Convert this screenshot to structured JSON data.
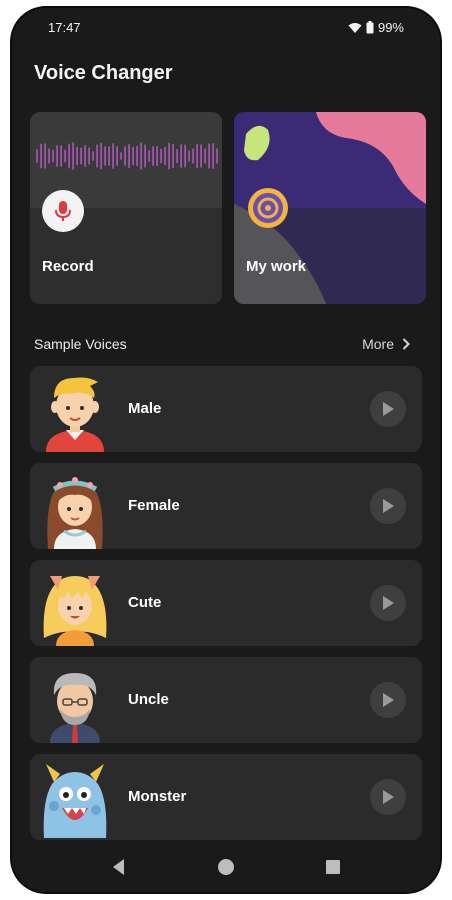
{
  "status": {
    "time": "17:47",
    "battery": "99%"
  },
  "app": {
    "title": "Voice Changer"
  },
  "cards": {
    "record": {
      "label": "Record"
    },
    "work": {
      "label": "My work"
    }
  },
  "section": {
    "title": "Sample Voices",
    "more": "More"
  },
  "voices": [
    {
      "name": "Male",
      "icon": "male-avatar-icon"
    },
    {
      "name": "Female",
      "icon": "female-avatar-icon"
    },
    {
      "name": "Cute",
      "icon": "cute-avatar-icon"
    },
    {
      "name": "Uncle",
      "icon": "uncle-avatar-icon"
    },
    {
      "name": "Monster",
      "icon": "monster-avatar-icon"
    }
  ],
  "icons": {
    "status": [
      "wifi-icon",
      "battery-icon"
    ],
    "record": "mic-icon",
    "work": "vinyl-disc-icon",
    "play": "play-icon",
    "more": "chevron-right-icon",
    "nav": [
      "back-icon",
      "home-icon",
      "recents-icon"
    ]
  },
  "colors": {
    "background": "#1a1a1a",
    "card": "#2b2b2b",
    "work_card": "#3b2b77",
    "accent_pink": "#e57a9c",
    "record_red": "#e0393e"
  }
}
